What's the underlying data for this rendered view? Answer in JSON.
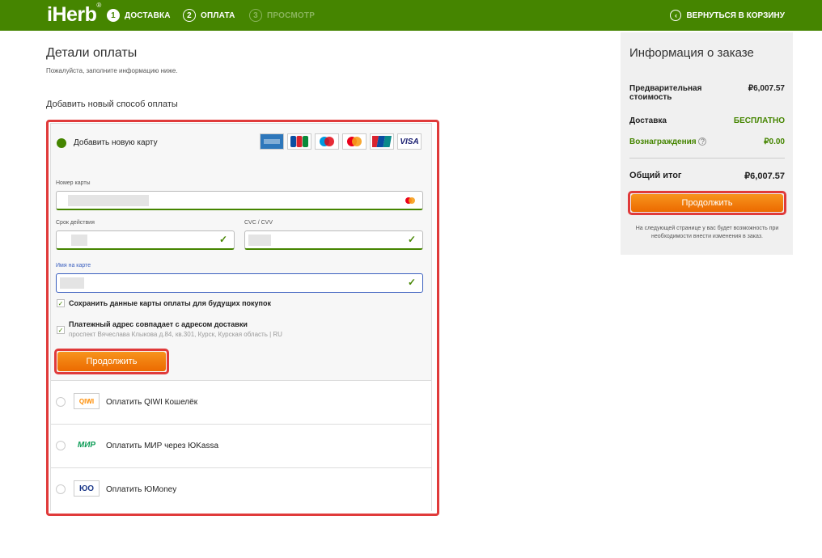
{
  "header": {
    "logo": "iHerb",
    "logo_mark": "®",
    "steps": [
      {
        "num": "1",
        "label": "ДОСТАВКА"
      },
      {
        "num": "2",
        "label": "ОПЛАТА"
      },
      {
        "num": "3",
        "label": "ПРОСМОТР"
      }
    ],
    "back_label": "ВЕРНУТЬСЯ В КОРЗИНУ",
    "brand_color": "#458500"
  },
  "payment": {
    "title": "Детали оплаты",
    "subtitle": "Пожалуйста, заполните информацию ниже.",
    "section_label": "Добавить новый способ оплаты",
    "add_card_label": "Добавить новую карту",
    "brands": [
      "AMEX",
      "JCB",
      "Maestro",
      "MC",
      "UnionPay",
      "VISA"
    ],
    "card_number_label": "Номер карты",
    "expiry_label": "Срок действия",
    "cvc_label": "CVC / CVV",
    "name_label": "Имя на карте",
    "save_card_label": "Сохранить данные карты оплаты для будущих покупок",
    "billing_same_label": "Платежный адрес совпадает с адресом доставки",
    "billing_address": "проспект Вячеслава Клыкова д.84, кв.301, Курск, Курская область | RU",
    "continue_label": "Продолжить",
    "alt_methods": [
      {
        "logo": "QIWI",
        "label": "Оплатить QIWI Кошелёк"
      },
      {
        "logo": "МИР",
        "label": "Оплатить МИР через ЮKassa"
      },
      {
        "logo": "ЮO",
        "label": "Оплатить ЮMoney"
      }
    ]
  },
  "summary": {
    "title": "Информация о заказе",
    "subtotal_label": "Предварительная стоимость",
    "subtotal_value": "₽6,007.57",
    "shipping_label": "Доставка",
    "shipping_value": "БЕСПЛАТНО",
    "rewards_label": "Вознаграждения",
    "rewards_value": "₽0.00",
    "total_label": "Общий итог",
    "total_value": "₽6,007.57",
    "continue_label": "Продолжить",
    "note": "На следующей странице у вас будет возможность при необходимости внести изменения в заказ."
  }
}
